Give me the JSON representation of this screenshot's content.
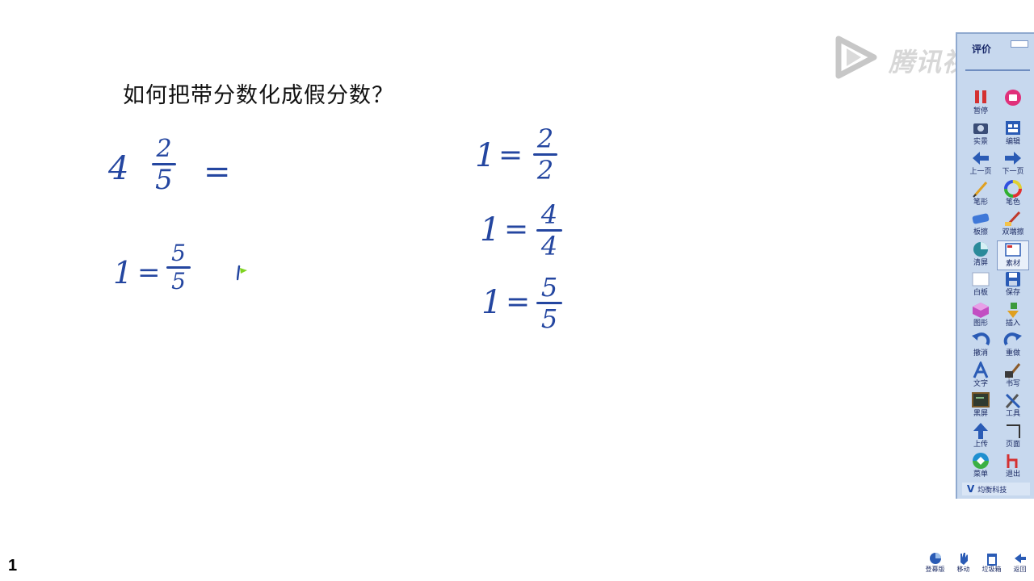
{
  "question": "如何把带分数化成假分数？",
  "page_number": "1",
  "handwriting": {
    "mixed_whole": "4",
    "mixed_num": "2",
    "mixed_den": "5",
    "equals": "=",
    "one": "1",
    "left_num": "5",
    "left_den": "5",
    "right_rows": [
      {
        "num": "2",
        "den": "2"
      },
      {
        "num": "4",
        "den": "4"
      },
      {
        "num": "5",
        "den": "5"
      }
    ]
  },
  "watermark": "腾讯视频",
  "toolbar": {
    "header": "评价",
    "footer_logo": "V",
    "footer_brand": "均衡科技",
    "buttons": [
      {
        "label": "暂停",
        "icon": "pause-icon"
      },
      {
        "label": "",
        "icon": "record-icon"
      },
      {
        "label": "实景",
        "icon": "camera-icon"
      },
      {
        "label": "编辑",
        "icon": "edit-window-icon"
      },
      {
        "label": "上一页",
        "icon": "arrow-left-icon"
      },
      {
        "label": "下一页",
        "icon": "arrow-right-icon"
      },
      {
        "label": "笔形",
        "icon": "pen-icon"
      },
      {
        "label": "笔色",
        "icon": "color-wheel-icon"
      },
      {
        "label": "板擦",
        "icon": "eraser-icon"
      },
      {
        "label": "双端擦",
        "icon": "double-eraser-icon"
      },
      {
        "label": "清屏",
        "icon": "clear-screen-icon"
      },
      {
        "label": "素材",
        "icon": "material-icon"
      },
      {
        "label": "白板",
        "icon": "whiteboard-icon"
      },
      {
        "label": "保存",
        "icon": "save-icon"
      },
      {
        "label": "图形",
        "icon": "shape-icon"
      },
      {
        "label": "插入",
        "icon": "insert-icon"
      },
      {
        "label": "撤消",
        "icon": "undo-icon"
      },
      {
        "label": "重做",
        "icon": "redo-icon"
      },
      {
        "label": "文字",
        "icon": "text-icon"
      },
      {
        "label": "书写",
        "icon": "writing-icon"
      },
      {
        "label": "黑屏",
        "icon": "blackboard-icon"
      },
      {
        "label": "工具",
        "icon": "tools-icon"
      },
      {
        "label": "上传",
        "icon": "upload-icon"
      },
      {
        "label": "页面",
        "icon": "page-icon"
      },
      {
        "label": "菜单",
        "icon": "menu-icon"
      },
      {
        "label": "退出",
        "icon": "exit-icon"
      }
    ]
  },
  "bottom_tools": [
    {
      "label": "登幕版",
      "icon": "screen-icon"
    },
    {
      "label": "移动",
      "icon": "hand-move-icon"
    },
    {
      "label": "垃圾箱",
      "icon": "trash-icon"
    },
    {
      "label": "返回",
      "icon": "back-icon"
    }
  ],
  "colors": {
    "ink": "#2446a0",
    "toolbar_bg": "#c7d8ee",
    "toolbar_border": "#8fa9cf"
  }
}
